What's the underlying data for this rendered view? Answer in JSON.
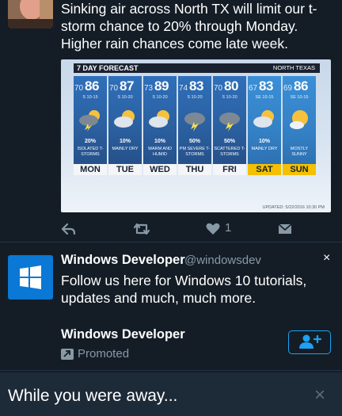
{
  "tweet": {
    "text": "Sinking air across North TX will limit our t-storm chance to 20% through Monday. Higher rain chances come late week.",
    "forecast_image": {
      "title": "7 DAY FORECAST",
      "region": "NORTH TEXAS",
      "updated": "UPDATED: 5/22/2016 10:30 PM",
      "days": [
        {
          "low": "70",
          "high": "86",
          "wind": "S 10-15",
          "pct": "20%",
          "cond": "ISOLATED T-STORMS",
          "name": "MON",
          "icon": "storm-cloud-icon"
        },
        {
          "low": "70",
          "high": "87",
          "wind": "S 10-20",
          "pct": "10%",
          "cond": "MAINLY DRY",
          "name": "TUE",
          "icon": "partly-cloudy-icon"
        },
        {
          "low": "73",
          "high": "89",
          "wind": "S 10-20",
          "pct": "10%",
          "cond": "WARM AND HUMID",
          "name": "WED",
          "icon": "partly-cloudy-icon"
        },
        {
          "low": "74",
          "high": "83",
          "wind": "S 10-20",
          "pct": "50%",
          "cond": "PM SEVERE T-STORMS",
          "name": "THU",
          "icon": "storm-cloud-icon"
        },
        {
          "low": "70",
          "high": "80",
          "wind": "S 10-20",
          "pct": "50%",
          "cond": "SCATTERED T-STORMS",
          "name": "FRI",
          "icon": "storm-cloud-icon"
        },
        {
          "low": "67",
          "high": "83",
          "wind": "SE 10-15",
          "pct": "10%",
          "cond": "MAINLY DRY",
          "name": "SAT",
          "icon": "partly-cloudy-icon"
        },
        {
          "low": "69",
          "high": "86",
          "wind": "SE 10-15",
          "pct": "",
          "cond": "MOSTLY SUNNY",
          "name": "SUN",
          "icon": "sun-cloud-icon"
        }
      ]
    },
    "actions": {
      "like_count": "1"
    }
  },
  "promoted": {
    "name": "Windows Developer",
    "handle": "@windowsdev",
    "close": "×",
    "text": "Follow us here for Windows 10 tutorials, updates and much, much more.",
    "account_name": "Windows Developer",
    "promoted_label": "Promoted"
  },
  "away_bar": {
    "text": "While you were away...",
    "close": "×"
  },
  "colors": {
    "background": "#141d26",
    "accent": "#1da1f2",
    "muted": "#8899a6",
    "windows_blue": "#0a78d4",
    "weekend_yellow": "#f4c000"
  }
}
